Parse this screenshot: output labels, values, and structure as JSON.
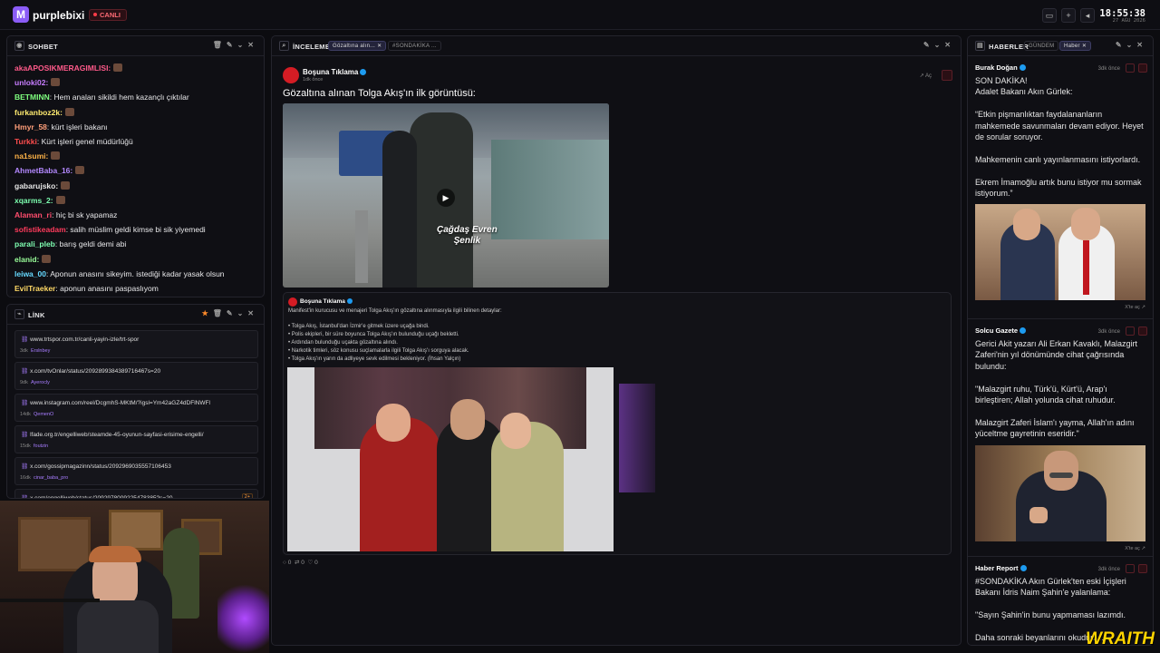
{
  "topbar": {
    "brand": "purplebixi",
    "live": "CANLI",
    "time": "18:55:38",
    "date": "27 AĞU 2026"
  },
  "chat": {
    "title": "SOHBET",
    "messages": [
      {
        "user": "akaAPOSIKMERAGIMLISI:",
        "text": "",
        "color": "#ff5a8a",
        "emote": true
      },
      {
        "user": "unloki02:",
        "text": "",
        "color": "#c77dff",
        "emote": true
      },
      {
        "user": "BETMINN",
        "text": ": Hem anaları sikildi hem kazançlı çıktılar",
        "color": "#7fff7f"
      },
      {
        "user": "furkanboz2k:",
        "text": "",
        "color": "#ffeb70",
        "emote": true
      },
      {
        "user": "Hmyr_58",
        "text": ": kürt işleri bakanı",
        "color": "#ff9f7a"
      },
      {
        "user": "Turkki",
        "text": ": Kürt işleri genel müdürlüğü",
        "color": "#ff4d4d"
      },
      {
        "user": "na1sumi:",
        "text": "",
        "color": "#ffb347",
        "emote": true
      },
      {
        "user": "AhmetBaba_16:",
        "text": "",
        "color": "#b388ff",
        "emote": true
      },
      {
        "user": "gabarujsko:",
        "text": "",
        "color": "#e6e6e6",
        "emote": true
      },
      {
        "user": "xqarms_2:",
        "text": "",
        "color": "#7dffb0",
        "emote": true
      },
      {
        "user": "Alaman_ri",
        "text": ": hiç bi sk yapamaz",
        "color": "#ff4d6d"
      },
      {
        "user": "sofistikeadam",
        "text": ": salih müslim geldi kimse bi sik yiyemedi",
        "color": "#ff3b5c"
      },
      {
        "user": "parali_pleb",
        "text": ": barış geldi demi abi",
        "color": "#7fffb2"
      },
      {
        "user": "elanid:",
        "text": "",
        "color": "#9aff9a",
        "emote": true
      },
      {
        "user": "leiwa_00",
        "text": ": Aponun anasını sikeyim. istediği kadar yasak olsun",
        "color": "#66d9ff"
      },
      {
        "user": "EvilTraeker",
        "text": ": aponun anasını paspaslıyom",
        "color": "#ffd966"
      }
    ]
  },
  "links": {
    "title": "LİNK",
    "items": [
      {
        "url": "www.trtspor.com.tr/canli-yayin-izle/trt-spor",
        "age": "3dk",
        "user": "Erslnbey"
      },
      {
        "url": "x.com/tvOnlar/status/2092899384389716467s=20",
        "age": "9dk",
        "user": "Ayerocly"
      },
      {
        "url": "www.instagram.com/reel/DcgmhS-MKtM/?igsl=Ym42aGZ4dDFlNWFl",
        "age": "14dk",
        "user": "QemenO"
      },
      {
        "url": "lfade.org.tr/engelliweb/steamde-45-oyunun-sayfasi-erisime-engelli/",
        "age": "15dk",
        "user": "foutzin"
      },
      {
        "url": "x.com/gossipmagazinn/status/2092969035557106453",
        "age": "16dk",
        "user": "cinar_baba_pro"
      },
      {
        "url": "x.com/engelliweb/status/2092978009225478385?s=20",
        "age": "",
        "user": "",
        "badge": "2+"
      }
    ]
  },
  "review": {
    "title": "İNCELEME",
    "tabs": [
      "Gözaltına alın...",
      "#SONDAKİKA ..."
    ],
    "author": "Boşuna Tıklama",
    "time": "1dk önce",
    "open": "Aç",
    "headline": "Gözaltına alınan Tolga Akış'ın ilk görüntüsü:",
    "video_caption": "Çağdaş Evren\nŞenlik",
    "quote_author": "Boşuna Tıklama",
    "quote_intro": "Manifest'in kurucusu ve menajeri Tolga Akış'ın gözaltına alınmasıyla ilgili bilinen detaylar:",
    "quote_bullets": [
      "• Tolga Akış, İstanbul'dan İzmir'e gitmek üzere uçağa bindi.",
      "• Polis ekipleri, bir süre boyunca Tolga Akış'ın bulunduğu uçağı bekletti.",
      "• Ardından bulunduğu uçakta gözaltına alındı.",
      "• Narkotik timleri, söz konusu suçlamalarla ilgili Tolga Akış'ı sorguya alacak.",
      "• Tolga Akış'ın yarın da adliyeye sevk edilmesi bekleniyor. (İhsan Yalçın)"
    ],
    "stats": [
      "0",
      "0",
      "0"
    ]
  },
  "news": {
    "title": "HABERLER",
    "tabs": [
      "GÜNDEM",
      "Haber"
    ],
    "items": [
      {
        "author": "Burak Doğan",
        "time": "3dk önce",
        "body": "SON DAKİKA!\nAdalet Bakanı Akın Gürlek:\n\n“Etkin pişmanlıktan faydalananların mahkemede savunmaları devam ediyor. Heyet de sorular soruyor.\n\nMahkemenin canlı yayınlanmasını istiyorlardı.\n\nEkrem İmamoğlu artık bunu istiyor mu sormak istiyorum.”",
        "footer": "X'te aç"
      },
      {
        "author": "Solcu Gazete",
        "time": "3dk önce",
        "body": "Gerici Akit yazarı Ali Erkan Kavaklı, Malazgirt Zaferi'nin yıl dönümünde cihat çağrısında bulundu:\n\n\"Malazgirt ruhu, Türk'ü, Kürt'ü, Arap'ı birleştiren; Allah yolunda cihat ruhudur.\n\nMalazgirt Zaferi İslam'ı yayma, Allah'ın adını yüceltme gayretinin eseridir.\"",
        "footer": "X'te aç"
      },
      {
        "author": "Haber Report",
        "time": "3dk önce",
        "body": "#SONDAKİKA Akın Gürlek'ten eski İçişleri Bakanı İdris Naim Şahin'e yalanlama:\n\n\"Sayın Şahin'in bunu yapmaması lazımdı.\n\nDaha sonraki beyanlarını okudum..."
      }
    ]
  },
  "watermark": "WRAITH",
  "colors": {
    "accent": "#8b5cf6",
    "live": "#ff3b47",
    "verified": "#1d9bf0"
  }
}
